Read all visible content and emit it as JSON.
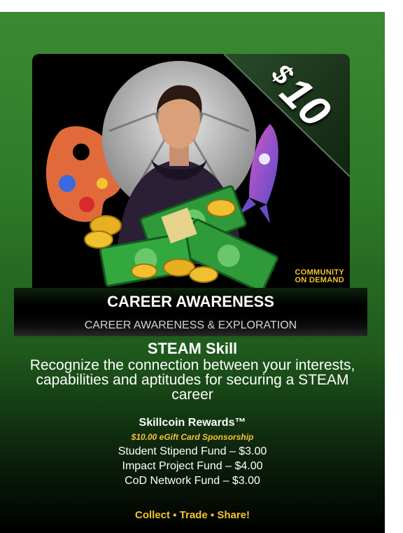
{
  "card": {
    "price_symbol": "$",
    "price_amount": "10",
    "logo": "COMMUNITY ON DEMAND",
    "title": "CAREER AWARENESS",
    "subtitle": "CAREER AWARENESS & EXPLORATION",
    "skill_heading": "STEAM Skill",
    "skill_description": "Recognize the connection between your interests, capabilities and aptitudes for securing a STEAM career",
    "rewards_heading": "Skillcoin Rewards™",
    "sponsorship": "$10.00 eGift Card Sponsorship",
    "funds": [
      "Student Stipend Fund – $3.00",
      "Impact Project Fund – $4.00",
      "CoD Network Fund – $3.00"
    ],
    "cta": "Collect ▪ Trade ▪ Share!"
  },
  "colors": {
    "accent_gold": "#f5c230",
    "card_green": "#3a8a32",
    "price_ribbon": "#1a3a1a"
  },
  "icons": [
    "palette-icon",
    "soccer-ball-icon",
    "rocket-icon",
    "person-hoodie-icon",
    "cash-stack-icon",
    "gold-coin-icon"
  ]
}
